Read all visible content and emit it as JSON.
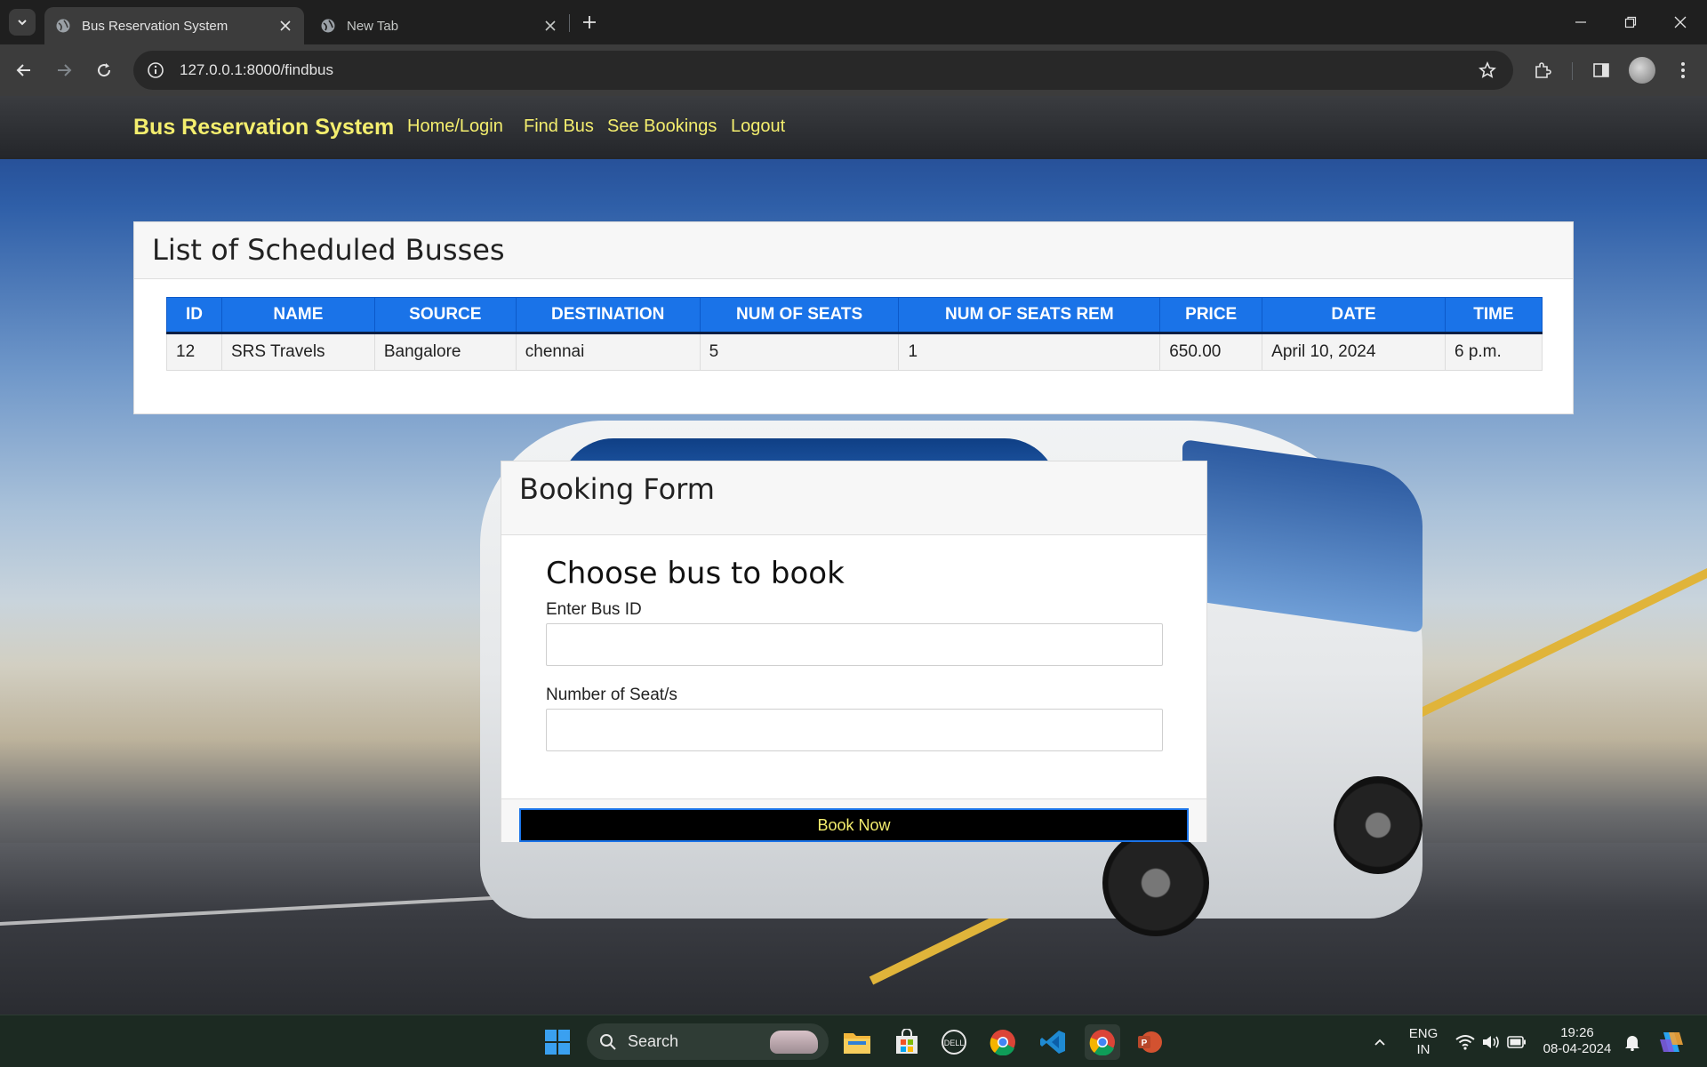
{
  "browser": {
    "tabs": [
      {
        "title": "Bus Reservation System",
        "active": true
      },
      {
        "title": "New Tab",
        "active": false
      }
    ],
    "url": "127.0.0.1:8000/findbus"
  },
  "site": {
    "brand": "Bus Reservation System",
    "nav": [
      "Home/Login",
      "Find Bus",
      "See Bookings",
      "Logout"
    ]
  },
  "list": {
    "title": "List of Scheduled Busses",
    "columns": [
      "ID",
      "NAME",
      "SOURCE",
      "DESTINATION",
      "NUM OF SEATS",
      "NUM OF SEATS REM",
      "PRICE",
      "DATE",
      "TIME"
    ],
    "rows": [
      [
        "12",
        "SRS Travels",
        "Bangalore",
        "chennai",
        "5",
        "1",
        "650.00",
        "April 10, 2024",
        "6 p.m."
      ]
    ]
  },
  "booking": {
    "title": "Booking Form",
    "heading": "Choose bus to book",
    "bus_id_label": "Enter Bus ID",
    "bus_id_value": "",
    "seats_label": "Number of Seat/s",
    "seats_value": "",
    "submit_label": "Book Now"
  },
  "taskbar": {
    "search_label": "Search",
    "lang_top": "ENG",
    "lang_bottom": "IN",
    "time": "19:26",
    "date": "08-04-2024"
  },
  "colors": {
    "brand_yellow": "#f4ee6e",
    "table_header": "#1a73e8"
  }
}
